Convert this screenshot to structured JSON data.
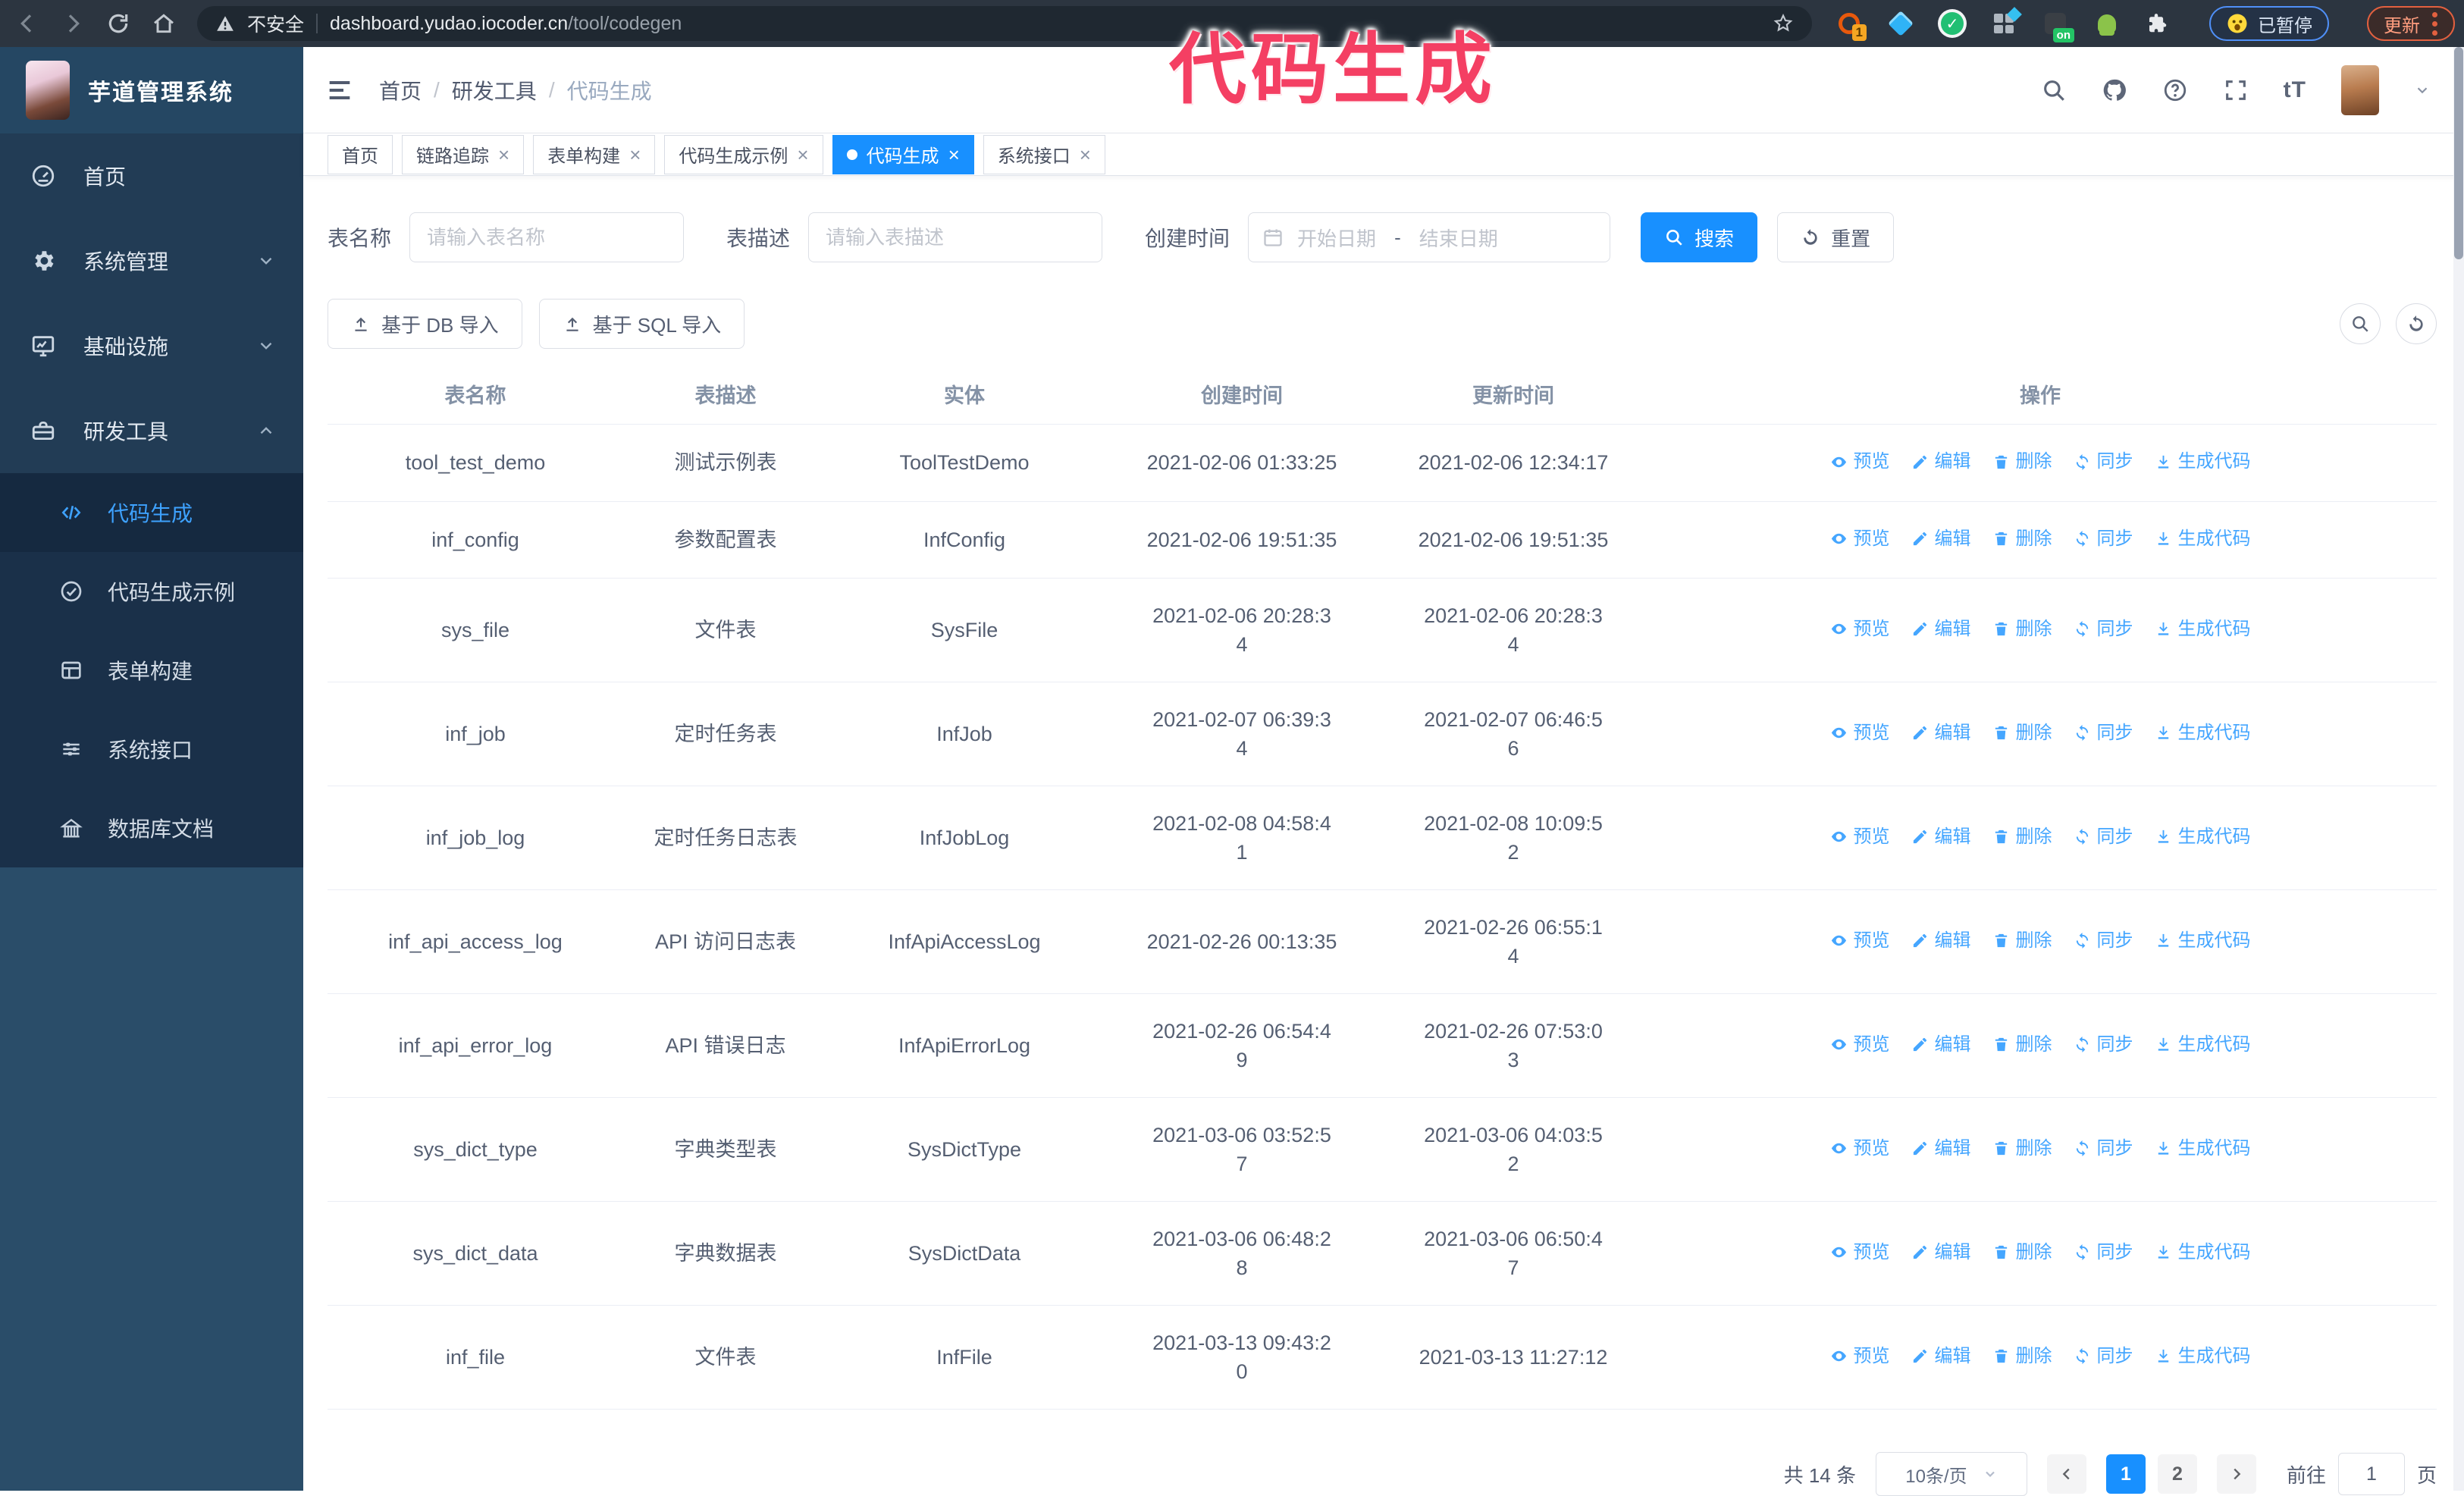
{
  "browser": {
    "security_label": "不安全",
    "url_host": "dashboard.yudao.iocoder.cn",
    "url_path": "/tool/codegen",
    "ext_badge_count": "1",
    "ext_badge_on": "on",
    "paused_badge": "已暂停",
    "update_badge": "更新"
  },
  "overlay": {
    "title": "代码生成",
    "color": "#f43f63"
  },
  "sidebar": {
    "app_title": "芋道管理系统",
    "items": [
      {
        "label": "首页",
        "icon": "dashboard",
        "chevron": ""
      },
      {
        "label": "系统管理",
        "icon": "gear",
        "chevron": "down"
      },
      {
        "label": "基础设施",
        "icon": "monitor",
        "chevron": "down"
      },
      {
        "label": "研发工具",
        "icon": "toolbox",
        "chevron": "up"
      }
    ],
    "submenu": [
      {
        "label": "代码生成",
        "icon": "code",
        "active": true
      },
      {
        "label": "代码生成示例",
        "icon": "check-circle",
        "active": false
      },
      {
        "label": "表单构建",
        "icon": "form",
        "active": false
      },
      {
        "label": "系统接口",
        "icon": "sliders",
        "active": false
      },
      {
        "label": "数据库文档",
        "icon": "db-doc",
        "active": false
      }
    ]
  },
  "header": {
    "breadcrumb": [
      "首页",
      "研发工具",
      "代码生成"
    ],
    "font_size_icon_text": "tT"
  },
  "tabs": [
    {
      "label": "首页",
      "closable": false,
      "active": false
    },
    {
      "label": "链路追踪",
      "closable": true,
      "active": false
    },
    {
      "label": "表单构建",
      "closable": true,
      "active": false
    },
    {
      "label": "代码生成示例",
      "closable": true,
      "active": false
    },
    {
      "label": "代码生成",
      "closable": true,
      "active": true
    },
    {
      "label": "系统接口",
      "closable": true,
      "active": false
    }
  ],
  "filters": {
    "name_label": "表名称",
    "name_placeholder": "请输入表名称",
    "desc_label": "表描述",
    "desc_placeholder": "请输入表描述",
    "time_label": "创建时间",
    "start_placeholder": "开始日期",
    "range_separator": "-",
    "end_placeholder": "结束日期",
    "search_label": "搜索",
    "reset_label": "重置"
  },
  "toolbar": {
    "import_db_label": "基于 DB 导入",
    "import_sql_label": "基于 SQL 导入"
  },
  "table": {
    "columns": [
      "表名称",
      "表描述",
      "实体",
      "创建时间",
      "更新时间",
      "操作"
    ],
    "action_labels": [
      "预览",
      "编辑",
      "删除",
      "同步",
      "生成代码"
    ],
    "rows": [
      {
        "name": "tool_test_demo",
        "desc": "测试示例表",
        "entity": "ToolTestDemo",
        "created": "2021-02-06 01:33:25",
        "updated": "2021-02-06 12:34:17"
      },
      {
        "name": "inf_config",
        "desc": "参数配置表",
        "entity": "InfConfig",
        "created": "2021-02-06 19:51:35",
        "updated": "2021-02-06 19:51:35"
      },
      {
        "name": "sys_file",
        "desc": "文件表",
        "entity": "SysFile",
        "created": "2021-02-06 20:28:3\n4",
        "updated": "2021-02-06 20:28:3\n4"
      },
      {
        "name": "inf_job",
        "desc": "定时任务表",
        "entity": "InfJob",
        "created": "2021-02-07 06:39:3\n4",
        "updated": "2021-02-07 06:46:5\n6"
      },
      {
        "name": "inf_job_log",
        "desc": "定时任务日志表",
        "entity": "InfJobLog",
        "created": "2021-02-08 04:58:4\n1",
        "updated": "2021-02-08 10:09:5\n2"
      },
      {
        "name": "inf_api_access_log",
        "desc": "API 访问日志表",
        "entity": "InfApiAccessLog",
        "created": "2021-02-26 00:13:35",
        "updated": "2021-02-26 06:55:1\n4"
      },
      {
        "name": "inf_api_error_log",
        "desc": "API 错误日志",
        "entity": "InfApiErrorLog",
        "created": "2021-02-26 06:54:4\n9",
        "updated": "2021-02-26 07:53:0\n3"
      },
      {
        "name": "sys_dict_type",
        "desc": "字典类型表",
        "entity": "SysDictType",
        "created": "2021-03-06 03:52:5\n7",
        "updated": "2021-03-06 04:03:5\n2"
      },
      {
        "name": "sys_dict_data",
        "desc": "字典数据表",
        "entity": "SysDictData",
        "created": "2021-03-06 06:48:2\n8",
        "updated": "2021-03-06 06:50:4\n7"
      },
      {
        "name": "inf_file",
        "desc": "文件表",
        "entity": "InfFile",
        "created": "2021-03-13 09:43:2\n0",
        "updated": "2021-03-13 11:27:12"
      }
    ]
  },
  "pagination": {
    "total_label": "共 14 条",
    "page_size_label": "10条/页",
    "pages": [
      "1",
      "2"
    ],
    "active_page": "1",
    "goto_label": "前往",
    "goto_value": "1",
    "goto_suffix": "页"
  },
  "colors": {
    "accent": "#1890ff",
    "link": "#45a6ff",
    "sidebar_bg": "#2a4d69",
    "submenu_bg": "#1a3049"
  }
}
